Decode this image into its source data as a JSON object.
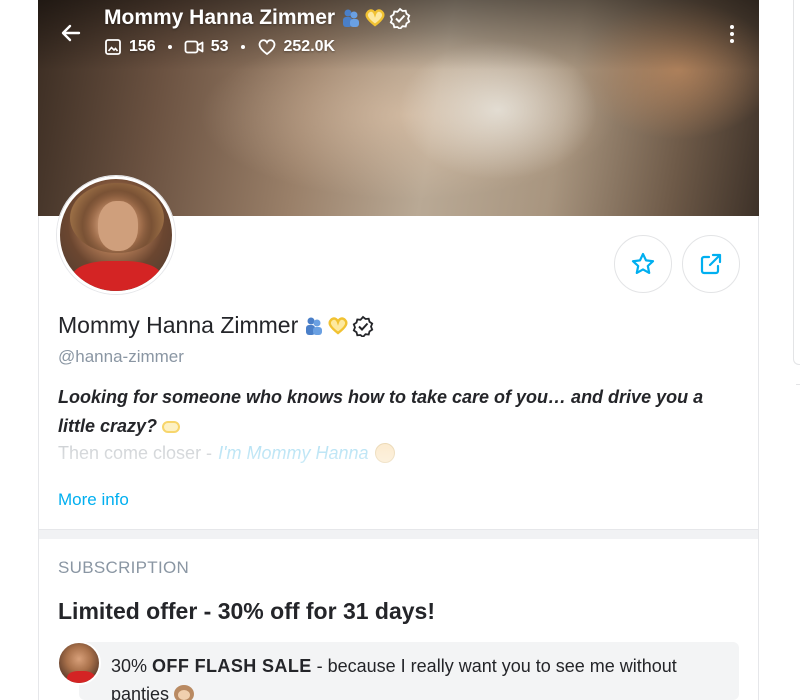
{
  "header": {
    "name": "Mommy Hanna Zimmer",
    "stats": {
      "photos": "156",
      "videos": "53",
      "likes": "252.0K"
    }
  },
  "profile": {
    "name": "Mommy Hanna Zimmer",
    "handle": "@hanna-zimmer",
    "bio_line1": "Looking for someone who knows how to take care of you… and drive you a little crazy?",
    "bio_line2_prefix": "Then come closer - ",
    "bio_line2_emphasis": "I'm Mommy Hanna",
    "more_info": "More info"
  },
  "subscription": {
    "section_title": "SUBSCRIPTION",
    "offer_title": "Limited offer - 30% off for 31 days!",
    "promo_percent": "30% ",
    "promo_bold": "OFF FLASH SALE",
    "promo_rest": " - because I really want you to see me without panties"
  },
  "icons": {
    "back": "arrow-left-icon",
    "photos": "image-icon",
    "videos": "video-icon",
    "likes": "heart-icon",
    "more": "kebab-menu-icon",
    "favorite": "star-icon",
    "share": "share-icon",
    "verified": "verified-badge-icon"
  },
  "colors": {
    "accent": "#00aff0",
    "muted": "#8a96a3",
    "text": "#242529"
  }
}
